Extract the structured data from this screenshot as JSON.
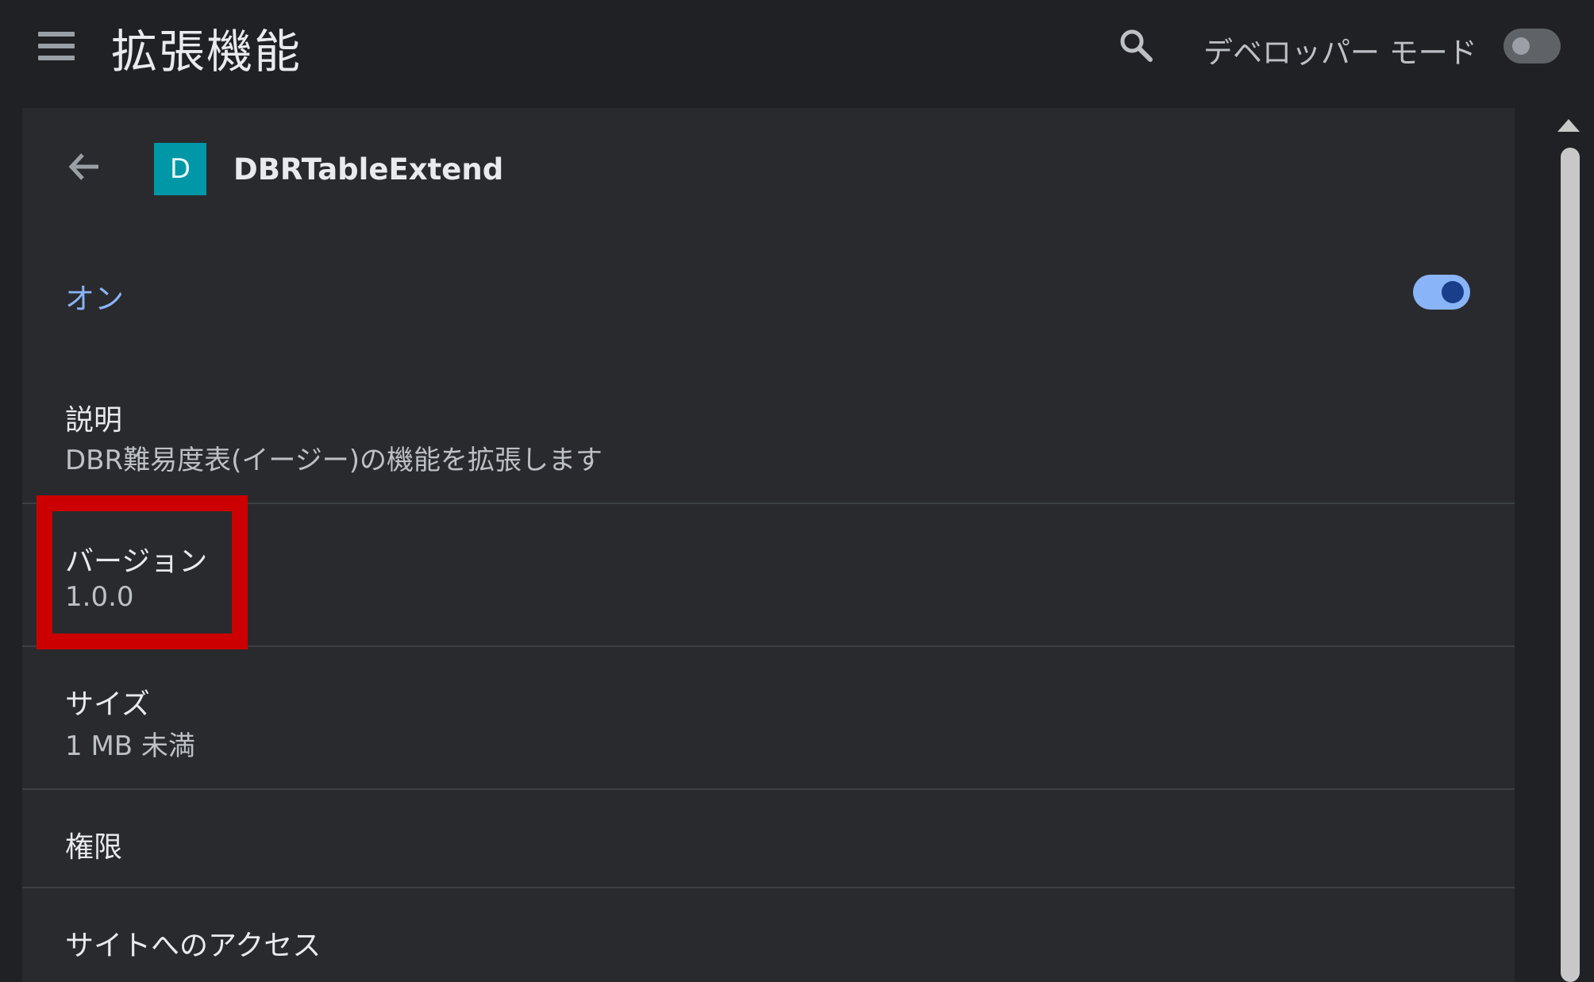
{
  "header": {
    "title": "拡張機能",
    "dev_mode_label": "デベロッパー モード",
    "dev_mode_on": false
  },
  "extension": {
    "icon_letter": "D",
    "icon_color": "#0097a7",
    "name": "DBRTableExtend",
    "enabled_label": "オン",
    "enabled": true
  },
  "details": {
    "description_label": "説明",
    "description_value": "DBR難易度表(イージー)の機能を拡張します",
    "version_label": "バージョン",
    "version_value": "1.0.0",
    "size_label": "サイズ",
    "size_value": "1 MB 未満",
    "permissions_label": "権限",
    "site_access_label": "サイトへのアクセス"
  },
  "colors": {
    "accent": "#8ab4f8",
    "highlight_border": "#cc0000",
    "background": "#202124",
    "card": "#292a2d"
  },
  "icons": [
    "menu-icon",
    "search-icon",
    "back-arrow-icon"
  ]
}
